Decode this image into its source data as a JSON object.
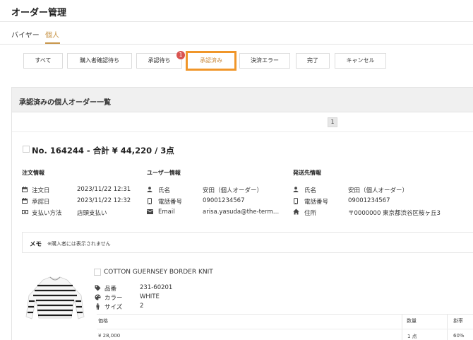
{
  "page": {
    "title": "オーダー管理"
  },
  "top_tabs": [
    {
      "label": "バイヤー"
    },
    {
      "label": "個人"
    }
  ],
  "status_tabs": [
    {
      "label": "すべて"
    },
    {
      "label": "購入者確認待ち"
    },
    {
      "label": "承認待ち"
    },
    {
      "label": "承認済み"
    },
    {
      "label": "決済エラー"
    },
    {
      "label": "完了"
    },
    {
      "label": "キャンセル"
    }
  ],
  "pending_badge": "1",
  "list": {
    "title": "承認済みの個人オーダー一覧",
    "page": "1"
  },
  "order": {
    "heading": "No. 164244 - 合計 ¥ 44,220 / 3点",
    "order_info": {
      "title": "注文情報",
      "order_date_label": "注文日",
      "order_date": "2023/11/22 12:31",
      "approved_date_label": "承認日",
      "approved_date": "2023/11/22 12:32",
      "payment_label": "支払い方法",
      "payment": "店頭支払い"
    },
    "user_info": {
      "title": "ユーザー情報",
      "name_label": "氏名",
      "name": "安田（個人オーダー）",
      "phone_label": "電話番号",
      "phone": "09001234567",
      "email_label": "Email",
      "email": "arisa.yasuda@the-term…"
    },
    "shipping_info": {
      "title": "発送先情報",
      "name_label": "氏名",
      "name": "安田（個人オーダー）",
      "phone_label": "電話番号",
      "phone": "09001234567",
      "address_label": "住所",
      "address": "〒0000000 東京都渋谷区桜ヶ丘3"
    },
    "memo": {
      "label": "メモ",
      "note": "※購入者には表示されません"
    },
    "item": {
      "name": "COTTON GUERNSEY BORDER KNIT",
      "sku_label": "品番",
      "sku": "231-60201",
      "color_label": "カラー",
      "color": "WHITE",
      "size_label": "サイズ",
      "size": "2",
      "price_header": "価格",
      "qty_header": "数量",
      "rate_header": "掛率",
      "price": "¥ 28,000",
      "qty": "1 点",
      "rate": "60%"
    }
  },
  "colors": {
    "accent": "#c8964a",
    "highlight": "#f0962a",
    "badge": "#d9534f"
  }
}
